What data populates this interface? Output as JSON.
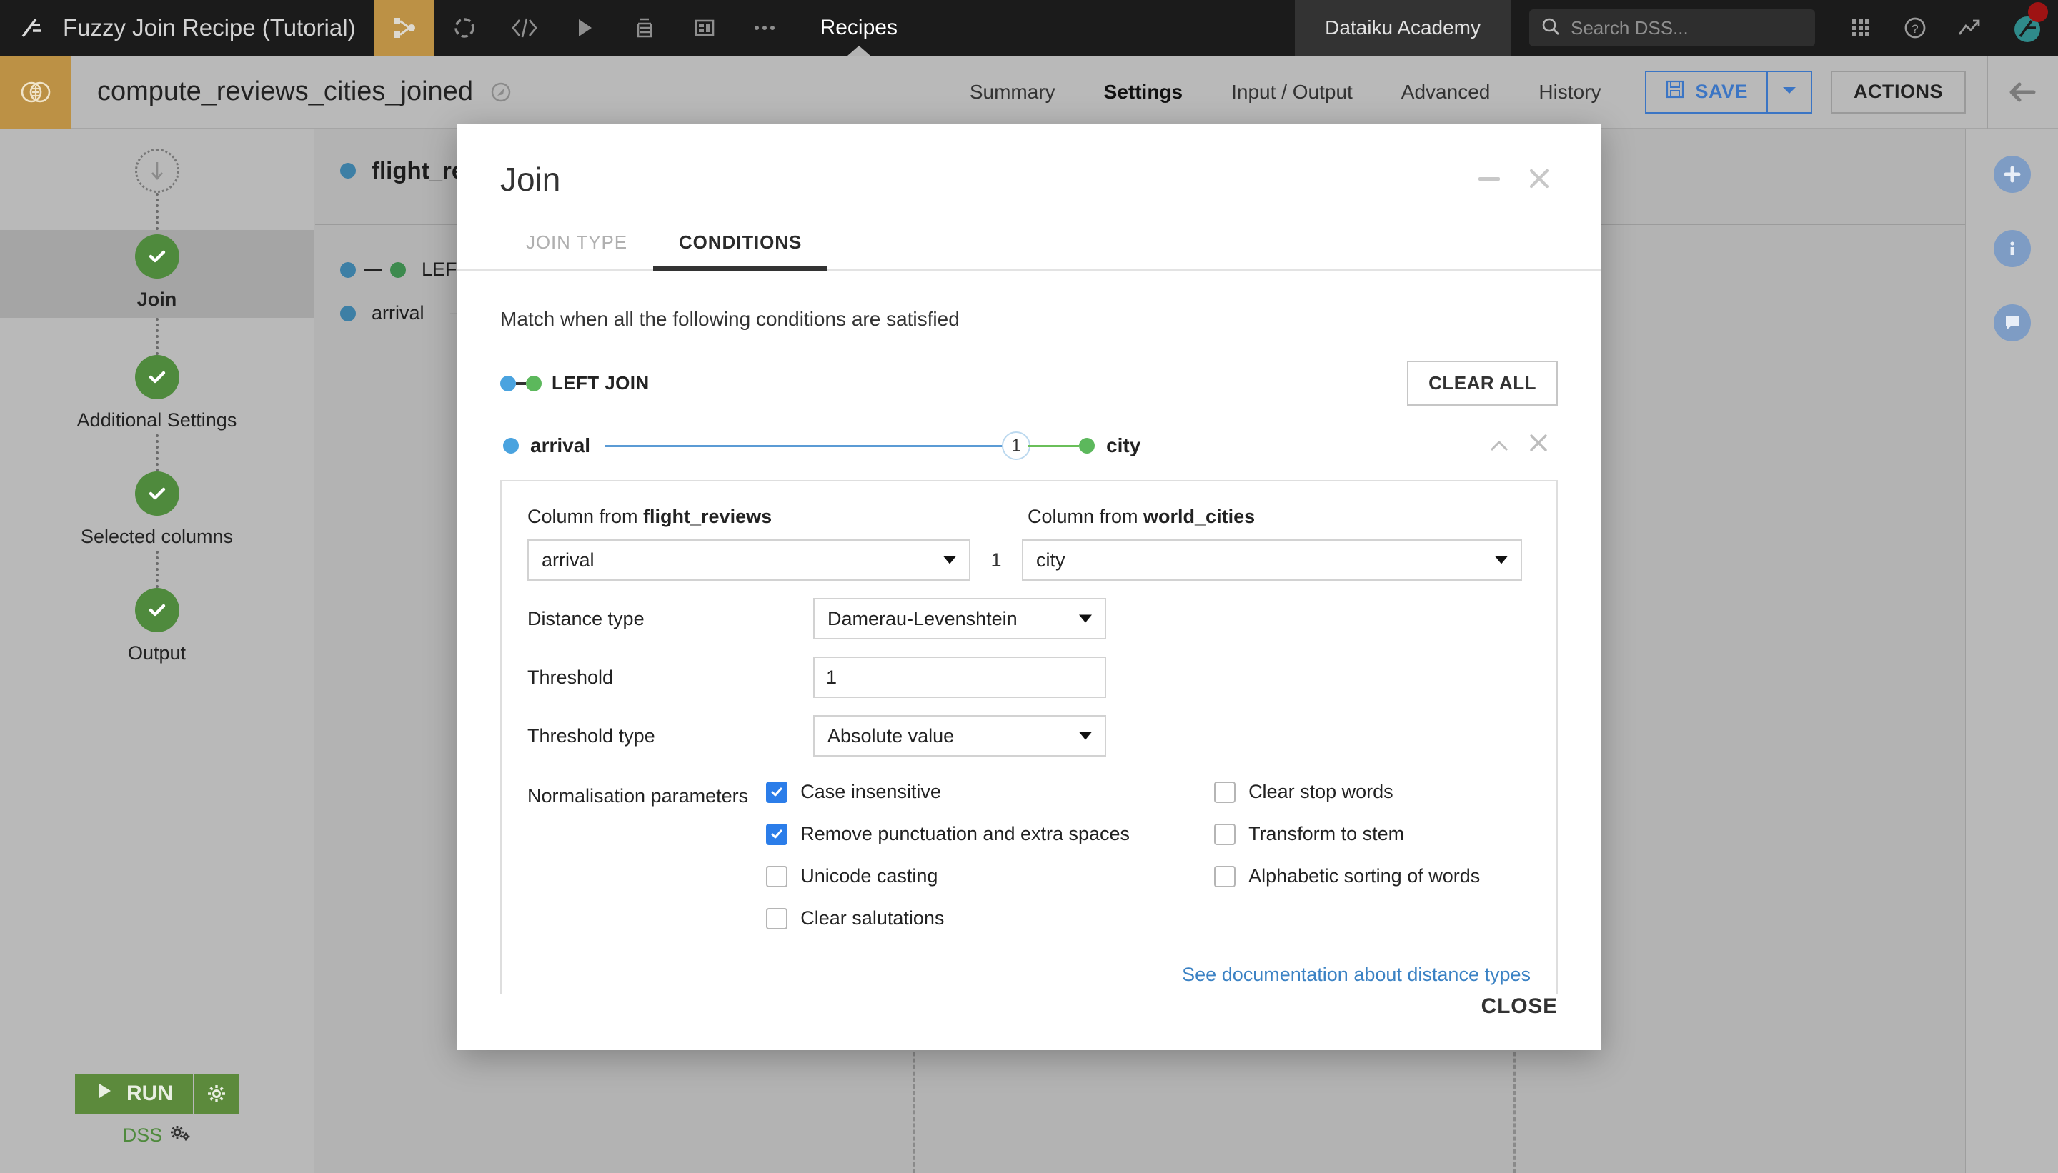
{
  "topnav": {
    "logo_icon": "dataiku-logo-icon",
    "project_title": "Fuzzy Join Recipe (Tutorial)",
    "icons": [
      {
        "name": "flow-icon",
        "glyph": "flow",
        "active": true
      },
      {
        "name": "lab-icon",
        "glyph": "lab",
        "active": false
      },
      {
        "name": "code-icon",
        "glyph": "code",
        "active": false
      },
      {
        "name": "jobs-icon",
        "glyph": "play",
        "active": false
      },
      {
        "name": "automation-icon",
        "glyph": "stack",
        "active": false
      },
      {
        "name": "dashboard-icon",
        "glyph": "dashboard",
        "active": false
      },
      {
        "name": "more-icon",
        "glyph": "ellipsis",
        "active": false
      }
    ],
    "recipes_label": "Recipes",
    "academy_label": "Dataiku Academy",
    "search_placeholder": "Search DSS...",
    "search_value": "",
    "right_icons": [
      "apps-grid-icon",
      "help-icon",
      "trend-icon",
      "avatar"
    ]
  },
  "subheader": {
    "badge_icon": "join-recipe-icon",
    "recipe_name": "compute_reviews_cities_joined",
    "globe_icon": "share-icon",
    "tabs": [
      {
        "label": "Summary",
        "active": false
      },
      {
        "label": "Settings",
        "active": true
      },
      {
        "label": "Input / Output",
        "active": false
      },
      {
        "label": "Advanced",
        "active": false
      },
      {
        "label": "History",
        "active": false
      }
    ],
    "save_label": "SAVE",
    "save_icon": "floppy-disk-icon",
    "save_caret_icon": "chevron-down-icon",
    "actions_label": "ACTIONS",
    "back_icon": "arrow-left-icon"
  },
  "sidebar": {
    "start_icon": "arrow-down-icon",
    "steps": [
      {
        "label": "Join",
        "selected": true
      },
      {
        "label": "Additional Settings",
        "selected": false
      },
      {
        "label": "Selected columns",
        "selected": false
      },
      {
        "label": "Output",
        "selected": false
      }
    ],
    "run_label": "RUN",
    "run_icon": "play-icon",
    "run_gear_icon": "gear-icon",
    "engine_label": "DSS",
    "engine_icon": "gears-icon"
  },
  "background_flow": {
    "dataset_label": "flight_reviews",
    "join_type_label": "LEFT JOIN",
    "condition_label": "arrival"
  },
  "right_rail": {
    "items": [
      {
        "name": "add-icon",
        "glyph": "+"
      },
      {
        "name": "info-icon",
        "glyph": "i"
      },
      {
        "name": "chat-icon",
        "glyph": "chat"
      }
    ]
  },
  "modal": {
    "title": "Join",
    "minimize_icon": "minimize-icon",
    "close_icon": "close-icon",
    "tabs": [
      {
        "label": "JOIN TYPE",
        "active": false
      },
      {
        "label": "CONDITIONS",
        "active": true
      }
    ],
    "match_text": "Match when all the following conditions are satisfied",
    "join_type_badge": "LEFT JOIN",
    "clear_all_label": "CLEAR ALL",
    "condition": {
      "left_column": "arrival",
      "right_column": "city",
      "link_number": "1",
      "collapse_icon": "chevron-up-icon",
      "remove_icon": "close-icon"
    },
    "editor": {
      "left_label_prefix": "Column from ",
      "left_dataset": "flight_reviews",
      "right_label_prefix": "Column from ",
      "right_dataset": "world_cities",
      "left_select_value": "arrival",
      "join_number": "1",
      "right_select_value": "city",
      "distance_type_label": "Distance type",
      "distance_type_value": "Damerau-Levenshtein",
      "threshold_label": "Threshold",
      "threshold_value": "1",
      "threshold_type_label": "Threshold type",
      "threshold_type_value": "Absolute value",
      "normalisation_label": "Normalisation parameters",
      "checkboxes_left": [
        {
          "label": "Case insensitive",
          "checked": true
        },
        {
          "label": "Remove punctuation and extra spaces",
          "checked": true
        },
        {
          "label": "Unicode casting",
          "checked": false
        },
        {
          "label": "Clear salutations",
          "checked": false
        }
      ],
      "checkboxes_right": [
        {
          "label": "Clear stop words",
          "checked": false
        },
        {
          "label": "Transform to stem",
          "checked": false
        },
        {
          "label": "Alphabetic sorting of words",
          "checked": false
        }
      ],
      "doc_link": "See documentation about distance types"
    },
    "add_condition_icon": "plus-icon",
    "close_label": "CLOSE"
  },
  "colors": {
    "topnav_bg": "#1b1b1b",
    "accent_gold": "#bc9145",
    "page_bg": "#b9b9b9",
    "green": "#4f8a3d",
    "blue_link": "#3b82c4",
    "checkbox_blue": "#2b7de9",
    "left_dot_blue": "#4aa3df",
    "right_dot_green": "#5cb85c"
  }
}
